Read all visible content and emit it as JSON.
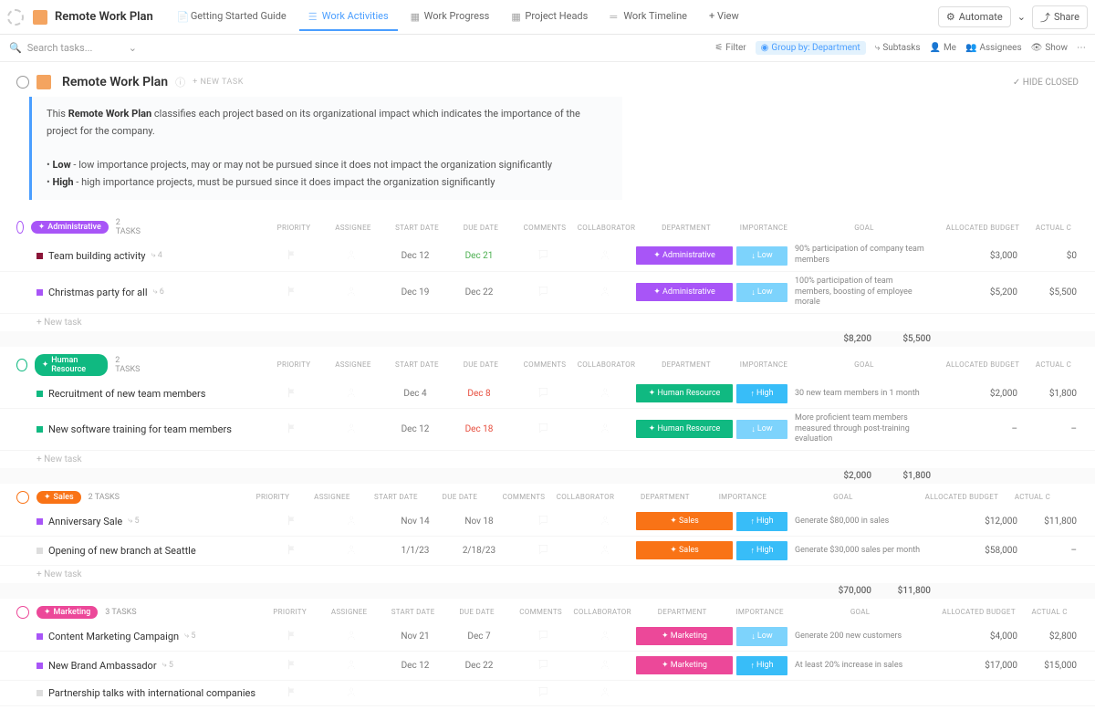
{
  "top": {
    "space": "Remote Work Plan",
    "views": [
      "Getting Started Guide",
      "Work Activities",
      "Work Progress",
      "Project Heads",
      "Work Timeline"
    ],
    "addView": "+ View",
    "automate": "Automate",
    "share": "Share"
  },
  "tool": {
    "search": "Search tasks...",
    "filter": "Filter",
    "group": "Group by: Department",
    "subtasks": "Subtasks",
    "me": "Me",
    "assignees": "Assignees",
    "show": "Show"
  },
  "page": {
    "title": "Remote Work Plan",
    "newtask": "+ NEW TASK",
    "hide": "HIDE CLOSED"
  },
  "info": {
    "l1a": "This ",
    "l1b": "Remote Work Plan",
    "l1c": " classifies each project based on its organizational impact which indicates the importance of the project for the company.",
    "l2a": "Low",
    "l2b": " - low importance projects, may or may not be pursued since it does not impact the organization significantly",
    "l3a": "High",
    "l3b": " - high importance projects, must be pursued since it does impact the organization significantly"
  },
  "cols": [
    "PRIORITY",
    "ASSIGNEE",
    "START DATE",
    "DUE DATE",
    "COMMENTS",
    "COLLABORATOR",
    "DEPARTMENT",
    "IMPORTANCE",
    "GOAL",
    "ALLOCATED BUDGET",
    "ACTUAL C"
  ],
  "groups": [
    {
      "name": "Administrative",
      "color": "purple",
      "gcolor": "#a855f7",
      "count": "2 TASKS",
      "rows": [
        {
          "name": "Team building activity",
          "sub": "4",
          "sd": "Dec 12",
          "dd": "Dec 21",
          "dc": "ddg",
          "dp": "Administrative",
          "dpc": "purple",
          "im": "Low",
          "imc": "lblue",
          "ar": "↓",
          "gl": "90% participation of company team members",
          "ab": "$3,000",
          "ac": "$0",
          "dot": "#8b1538"
        },
        {
          "name": "Christmas party for all",
          "sub": "6",
          "sd": "Dec 19",
          "dd": "Dec 22",
          "dc": "ddn",
          "dp": "Administrative",
          "dpc": "purple",
          "im": "Low",
          "imc": "lblue",
          "ar": "↓",
          "gl": "100% participation of team members, boosting of employee morale",
          "ab": "$5,200",
          "ac": "$5,500",
          "dot": "#a855f7"
        }
      ],
      "tab": "$8,200",
      "tac": "$5,500"
    },
    {
      "name": "Human Resource",
      "color": "teal",
      "gcolor": "#10b981",
      "count": "2 TASKS",
      "rows": [
        {
          "name": "Recruitment of new team members",
          "sub": "",
          "sd": "Dec 4",
          "dd": "Dec 8",
          "dc": "ddr",
          "dp": "Human Resource",
          "dpc": "teal",
          "im": "High",
          "imc": "mblue",
          "ar": "↑",
          "gl": "30 new team members in 1 month",
          "ab": "$2,000",
          "ac": "$1,800",
          "dot": "#10b981"
        },
        {
          "name": "New software training for team members",
          "sub": "",
          "sd": "Dec 12",
          "dd": "Dec 18",
          "dc": "ddr",
          "dp": "Human Resource",
          "dpc": "teal",
          "im": "Low",
          "imc": "lblue",
          "ar": "↓",
          "gl": "More proficient team members measured through post-training evaluation",
          "ab": "–",
          "ac": "–",
          "dot": "#10b981"
        }
      ],
      "tab": "$2,000",
      "tac": "$1,800"
    },
    {
      "name": "Sales",
      "color": "orange",
      "gcolor": "#f97316",
      "count": "2 TASKS",
      "rows": [
        {
          "name": "Anniversary Sale",
          "sub": "5",
          "sd": "Nov 14",
          "dd": "Nov 18",
          "dc": "ddn",
          "dp": "Sales",
          "dpc": "orange",
          "im": "High",
          "imc": "mblue",
          "ar": "↑",
          "gl": "Generate $80,000 in sales",
          "ab": "$12,000",
          "ac": "$11,800",
          "dot": "#a855f7"
        },
        {
          "name": "Opening of new branch at Seattle",
          "sub": "",
          "sd": "1/1/23",
          "dd": "2/18/23",
          "dc": "ddn",
          "dp": "Sales",
          "dpc": "orange",
          "im": "High",
          "imc": "mblue",
          "ar": "↑",
          "gl": "Generate $30,000 sales per month",
          "ab": "$58,000",
          "ac": "–",
          "dot": "#ddd"
        }
      ],
      "tab": "$70,000",
      "tac": "$11,800"
    },
    {
      "name": "Marketing",
      "color": "pink",
      "gcolor": "#ec4899",
      "count": "3 TASKS",
      "rows": [
        {
          "name": "Content Marketing Campaign",
          "sub": "5",
          "sd": "Nov 21",
          "dd": "Dec 7",
          "dc": "ddn",
          "dp": "Marketing",
          "dpc": "pink",
          "im": "Low",
          "imc": "lblue",
          "ar": "↓",
          "gl": "Generate 200 new customers",
          "ab": "$4,000",
          "ac": "$2,800",
          "dot": "#a855f7"
        },
        {
          "name": "New Brand Ambassador",
          "sub": "5",
          "sd": "Dec 12",
          "dd": "Dec 22",
          "dc": "ddn",
          "dp": "Marketing",
          "dpc": "pink",
          "im": "High",
          "imc": "mblue",
          "ar": "↑",
          "gl": "At least 20% increase in sales",
          "ab": "$17,000",
          "ac": "$15,000",
          "dot": "#a855f7"
        },
        {
          "name": "Partnership talks with international companies",
          "sub": "",
          "sd": "",
          "dd": "",
          "dc": "",
          "dp": "",
          "dpc": "",
          "im": "",
          "imc": "",
          "ar": "",
          "gl": "",
          "ab": "",
          "ac": "",
          "dot": "#ddd"
        }
      ],
      "tab": "",
      "tac": ""
    }
  ],
  "newtask": "+ New task"
}
